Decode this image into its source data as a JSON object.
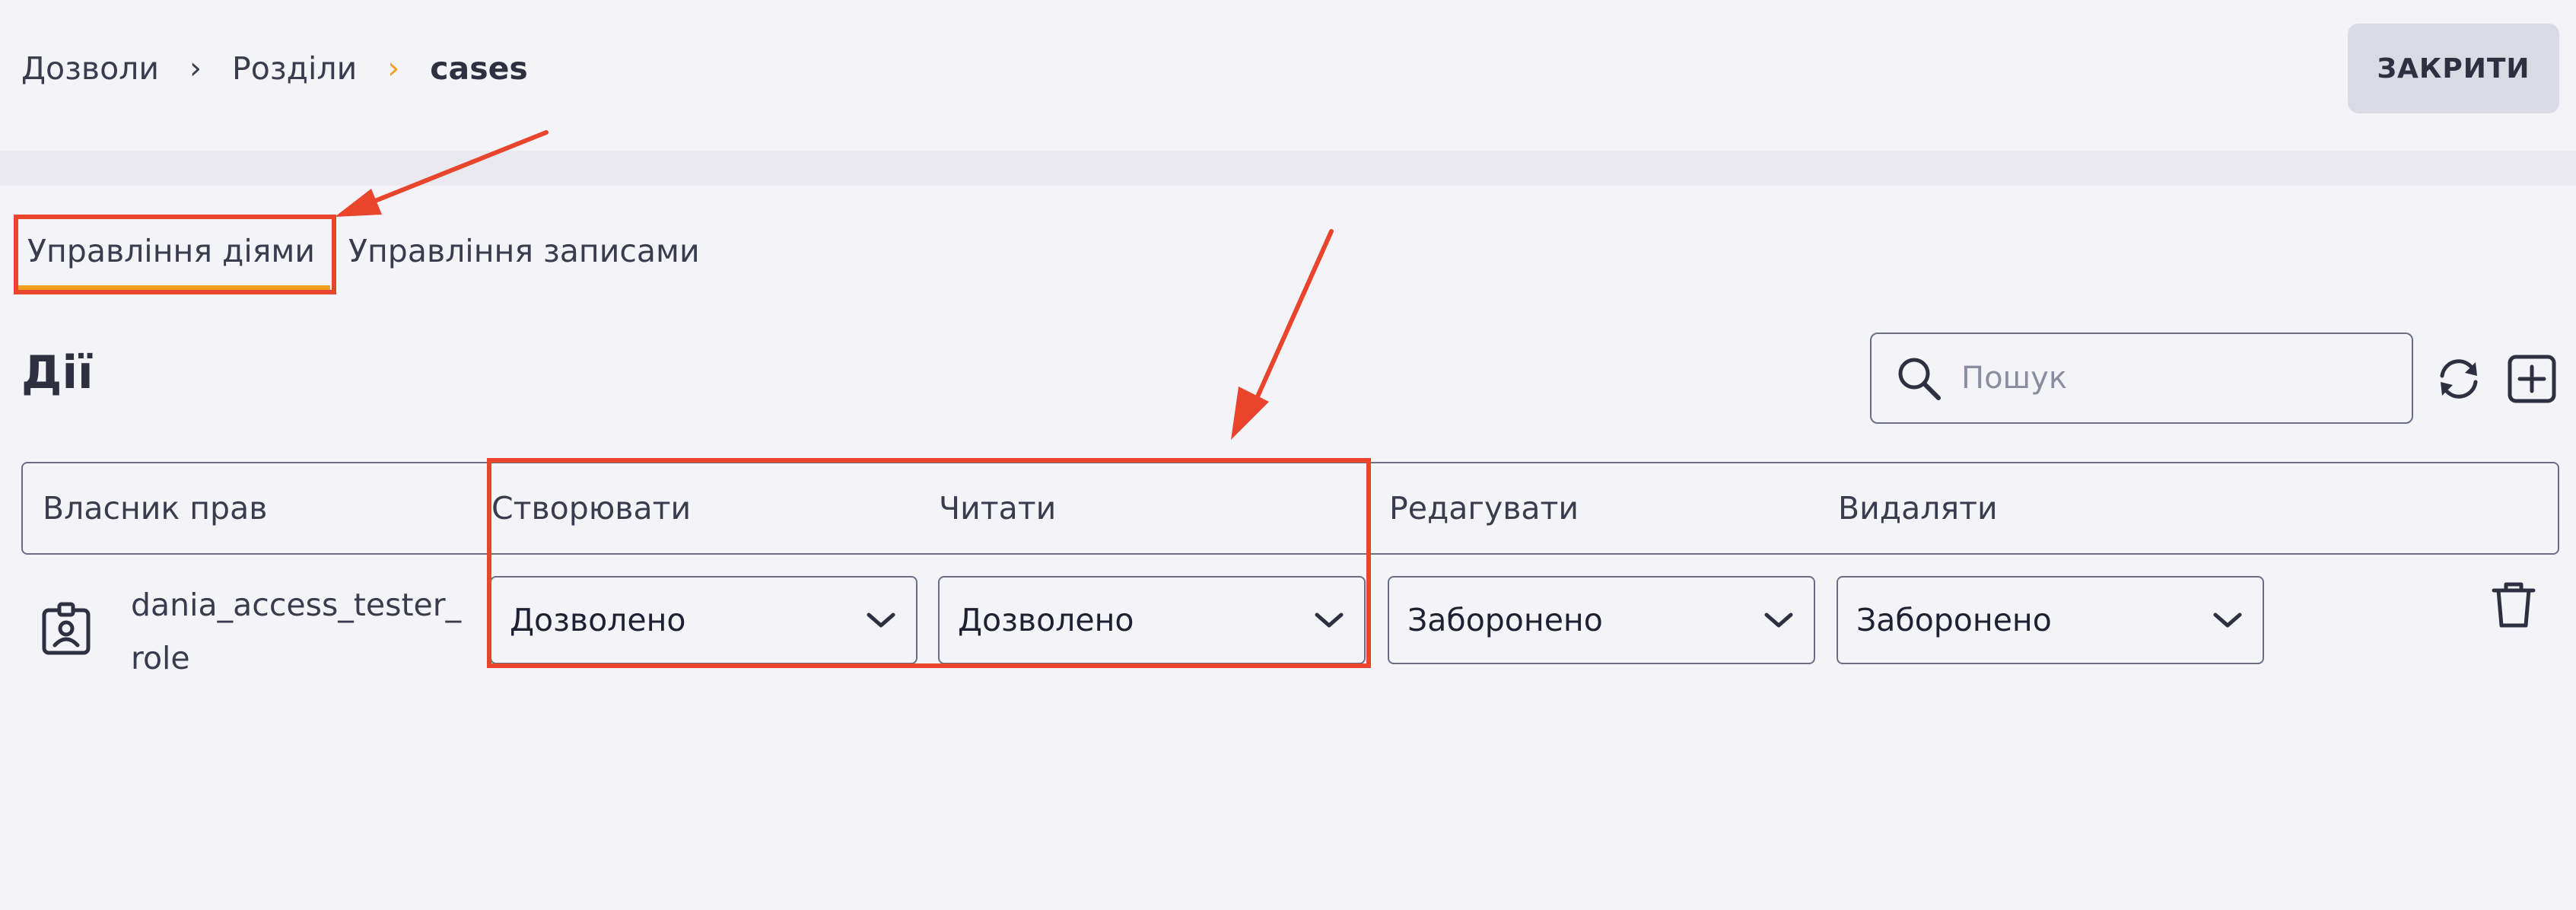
{
  "breadcrumb": {
    "items": [
      "Дозволи",
      "Розділи",
      "cases"
    ],
    "separator": "›"
  },
  "header": {
    "close_label": "ЗАКРИТИ"
  },
  "tabs": [
    {
      "label": "Управління діями",
      "active": true
    },
    {
      "label": "Управління записами",
      "active": false
    }
  ],
  "section": {
    "title": "Дії",
    "search_placeholder": "Пошук",
    "refresh_icon": "refresh-icon",
    "add_icon": "add-icon"
  },
  "table": {
    "columns": [
      "Власник прав",
      "Створювати",
      "Читати",
      "Редагувати",
      "Видаляти"
    ],
    "rows": [
      {
        "owner": "dania_access_tester_role",
        "owner_icon": "id-badge-icon",
        "create": "Дозволено",
        "read": "Дозволено",
        "update": "Заборонено",
        "delete": "Заборонено",
        "action_icon": "trash-icon"
      }
    ]
  },
  "colors": {
    "accent": "#f0a020",
    "annotation": "#e8452c",
    "background": "#f4f4f8",
    "button_bg": "#d9dae3"
  }
}
